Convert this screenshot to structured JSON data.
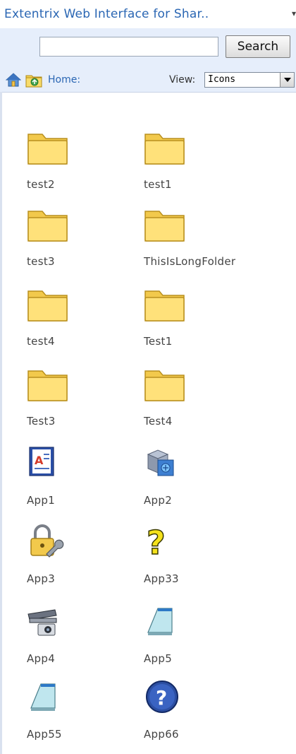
{
  "header": {
    "title": "Extentrix Web Interface for Shar..",
    "menu_arrow": "▾"
  },
  "search": {
    "placeholder": "",
    "button_label": "Search"
  },
  "nav": {
    "home_label": "Home:",
    "view_label": "View:",
    "view_selected": "Icons"
  },
  "items": [
    {
      "label": "test2",
      "icon": "folder-icon"
    },
    {
      "label": "test1",
      "icon": "folder-icon"
    },
    {
      "label": "test3",
      "icon": "folder-icon"
    },
    {
      "label": "ThisIsLongFolder",
      "icon": "folder-icon"
    },
    {
      "label": "test4",
      "icon": "folder-icon"
    },
    {
      "label": "Test1",
      "icon": "folder-icon"
    },
    {
      "label": "Test3",
      "icon": "folder-icon"
    },
    {
      "label": "Test4",
      "icon": "folder-icon"
    },
    {
      "label": "App1",
      "icon": "document-app-icon"
    },
    {
      "label": "App2",
      "icon": "network-cube-icon"
    },
    {
      "label": "App3",
      "icon": "lock-wrench-icon"
    },
    {
      "label": "App33",
      "icon": "question-mark-icon"
    },
    {
      "label": "App4",
      "icon": "scanner-camera-icon"
    },
    {
      "label": "App5",
      "icon": "notepad-icon"
    },
    {
      "label": "App55",
      "icon": "notepad-icon"
    },
    {
      "label": "App66",
      "icon": "help-circle-icon"
    }
  ]
}
